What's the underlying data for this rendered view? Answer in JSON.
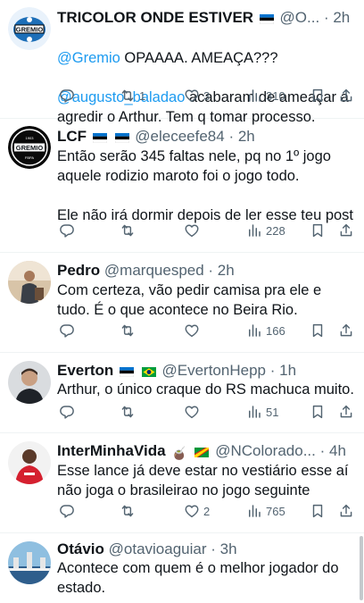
{
  "colors": {
    "text": "#0f1419",
    "muted": "#536471",
    "link": "#1d9bf0",
    "border": "#eff3f4"
  },
  "tweets": [
    {
      "name": "TRICOLOR ONDE ESTIVER",
      "handle": "@O...",
      "time": "· 2h",
      "text_mention1": "@Gremio",
      "text_part1": " OPAAAA. AMEAÇA???",
      "text_mention2": "@augusto_baladao",
      "text_part2": " acabaram de ameaçar a agredir o Arthur. Tem q tomar processo.",
      "replies": "",
      "retweets": "1",
      "likes": "3",
      "views": "310"
    },
    {
      "name": "LCF",
      "handle": "@eleceefe84",
      "time": "· 2h",
      "text": "Então serão 345 faltas nele, pq no 1º jogo aquele rodizio maroto foi o jogo todo.\n\nEle não irá dormir depois de ler esse teu post",
      "replies": "",
      "retweets": "",
      "likes": "",
      "views": "228"
    },
    {
      "name": "Pedro",
      "handle": "@marquesped",
      "time": "· 2h",
      "text": "Com certeza, vão pedir camisa pra ele e tudo. É o que acontece no Beira Rio.",
      "replies": "",
      "retweets": "",
      "likes": "",
      "views": "166"
    },
    {
      "name": "Everton",
      "handle": "@EvertonHepp",
      "time": "· 1h",
      "text": "Arthur, o único craque do RS machuca muito.",
      "replies": "",
      "retweets": "",
      "likes": "",
      "views": "51"
    },
    {
      "name": "InterMinhaVida",
      "handle": "@NColorado...",
      "time": "· 4h",
      "text": "Esse lance já deve estar no vestiário esse aí não joga o brasileirao no jogo seguinte",
      "replies": "",
      "retweets": "",
      "likes": "2",
      "views": "765"
    },
    {
      "name": "Otávio",
      "handle": "@otavioaguiar",
      "time": "· 3h",
      "text": "Acontece com quem é o melhor jogador do estado."
    }
  ],
  "icons": {
    "reply": "reply-icon",
    "retweet": "retweet-icon",
    "like": "heart-icon",
    "views": "views-icon",
    "bookmark": "bookmark-icon",
    "share": "share-icon"
  }
}
